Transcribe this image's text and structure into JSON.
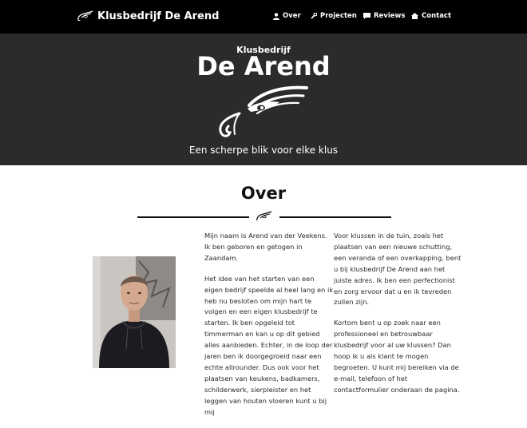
{
  "navbar": {
    "brand": "Klusbedrijf De Arend",
    "items": [
      {
        "label": "Over",
        "icon": "user-icon"
      },
      {
        "label": "Projecten",
        "icon": "wrench-icon"
      },
      {
        "label": "Reviews",
        "icon": "comment-icon"
      },
      {
        "label": "Contact",
        "icon": "home-icon"
      }
    ]
  },
  "hero": {
    "subtitle": "Klusbedrijf",
    "title": "De Arend",
    "tagline": "Een scherpe blik voor elke klus"
  },
  "about": {
    "title": "Over",
    "col1": [
      "Mijn naam is Arend van der Veekens. Ik ben geboren en getogen in Zaandam.",
      "Het idee van het starten van een eigen bedrijf speelde al heel lang en ik heb nu besloten om mijn hart te volgen en een eigen klusbedrijf te starten. Ik ben opgeleid tot timmerman en kan u op dit gebied alles aanbieden. Echter, in de loop der jaren ben ik doorgegroeid naar een echte allrounder. Dus ook voor het plaatsen van keukens, badkamers, schilderwerk, sierpleister en het leggen van houten vloeren kunt u bij mij"
    ],
    "col2": [
      "Voor klussen in de tuin, zoals het plaatsen van een nieuwe schutting, een veranda of een overkapping, bent u bij klusbedrijf De Arend aan het juiste adres. Ik ben een perfectionist en zorg ervoor dat u en ik tevreden zullen zijn.",
      "Kortom bent u op zoek naar een professioneel en betrouwbaar klusbedrijf voor al uw klussen? Dan hoop ik u als klant te mogen begroeten. U kunt mij bereiken via de e-mail, telefoon of het contactformulier onderaan de pagina."
    ]
  },
  "colors": {
    "navbar": "#000000",
    "hero": "#2b2b2b",
    "text": "#1c1c1c"
  }
}
